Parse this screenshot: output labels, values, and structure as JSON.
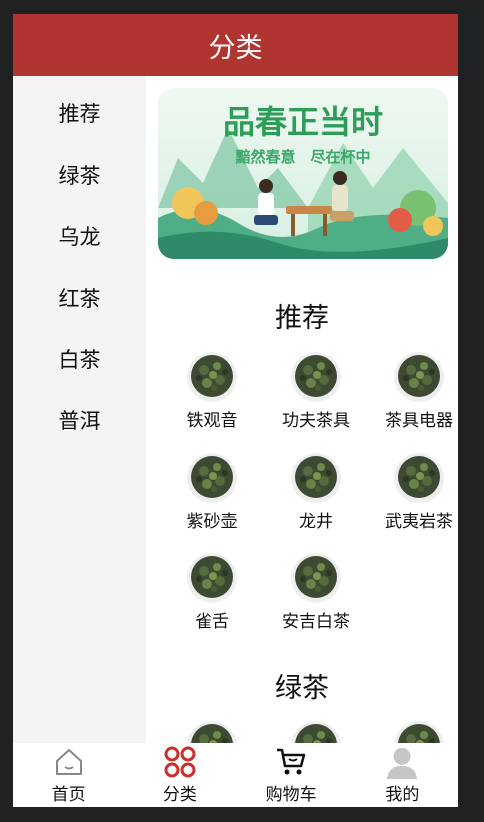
{
  "header": {
    "title": "分类"
  },
  "sidebar": {
    "items": [
      {
        "label": "推荐"
      },
      {
        "label": "绿茶"
      },
      {
        "label": "乌龙"
      },
      {
        "label": "红茶"
      },
      {
        "label": "白茶"
      },
      {
        "label": "普洱"
      }
    ]
  },
  "banner": {
    "headline": "品春正当时",
    "subline": "黯然春意　尽在杯中"
  },
  "sections": [
    {
      "title": "推荐",
      "items": [
        {
          "label": "铁观音"
        },
        {
          "label": "功夫茶具"
        },
        {
          "label": "茶具电器"
        },
        {
          "label": "紫砂壶"
        },
        {
          "label": "龙井"
        },
        {
          "label": "武夷岩茶"
        },
        {
          "label": "雀舌"
        },
        {
          "label": "安吉白茶"
        }
      ]
    },
    {
      "title": "绿茶",
      "items": []
    }
  ],
  "tabbar": {
    "items": [
      {
        "label": "首页",
        "icon": "home-icon"
      },
      {
        "label": "分类",
        "icon": "category-icon"
      },
      {
        "label": "购物车",
        "icon": "cart-icon"
      },
      {
        "label": "我的",
        "icon": "user-icon"
      }
    ]
  },
  "colors": {
    "brand": "#b03430",
    "sidebar_bg": "#f5f4f2",
    "active_tab": "#c8312b"
  }
}
